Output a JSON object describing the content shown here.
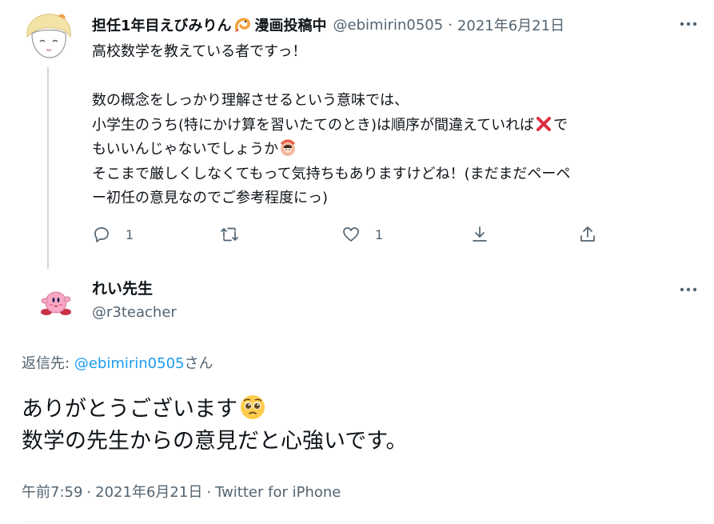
{
  "parent_tweet": {
    "display_name": "担任1年目えびみりん",
    "display_name_suffix": "漫画投稿中",
    "handle": "@ebimirin0505",
    "separator": "·",
    "date": "2021年6月21日",
    "name_emoji": "shrimp-icon",
    "body": {
      "line1": "高校数学を教えている者ですっ！",
      "line2": "数の概念をしっかり理解させるという意味では、",
      "line3a": "小学生のうち(特にかけ算を習いたてのとき)は順序が間違えていれば",
      "line3b": "で",
      "line4": "もいいんじゃないでしょうか",
      "line5": "そこまで厳しくしなくてもって気持ちもありますけどね！(まだまだペーペ",
      "line6": "ー初任の意見なのでご参考程度にっ)"
    },
    "emojis": [
      "cross-mark-icon",
      "ok-gesture-icon"
    ],
    "actions": {
      "reply_count": "1",
      "retweet_count": "",
      "like_count": "1"
    }
  },
  "main_tweet": {
    "display_name": "れい先生",
    "handle": "@r3teacher",
    "reply_to_label": "返信先:",
    "reply_to_mention": "@ebimirin0505",
    "reply_to_suffix": "さん",
    "body_line1": "ありがとうございます",
    "body_line2": "数学の先生からの意見だと心強いです。",
    "body_emoji": "pleading-face-icon",
    "time": "午前7:59",
    "date": "2021年6月21日",
    "separator": "·",
    "client": "Twitter for iPhone"
  },
  "colors": {
    "text": "#0f1419",
    "secondary": "#536471",
    "link": "#1d9bf0",
    "thread_line": "#cfd9de"
  }
}
